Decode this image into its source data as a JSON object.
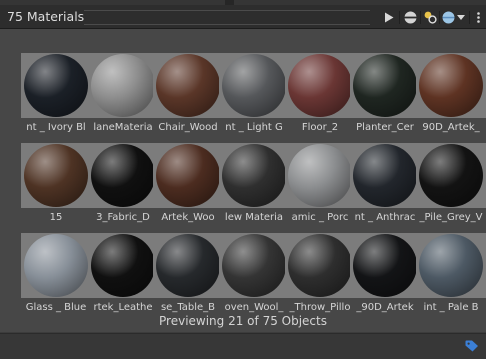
{
  "window": {
    "title": "75 Materials"
  },
  "footer": {
    "status": "Previewing 21 of 75 Objects"
  },
  "toolbar": {
    "icons": [
      "play-icon",
      "sphere-preview-icon",
      "light-toggle-icon",
      "environment-sphere-icon",
      "dropdown-arrow-icon",
      "more-options-icon"
    ]
  },
  "bottom_bar": {
    "icon": "tag-icon",
    "accent_color": "#3b7fd6"
  },
  "materials": [
    {
      "label": "nt _ Ivory Bl",
      "tone": "#1b2027"
    },
    {
      "label": "laneMateria",
      "tone": "#8d8d8d"
    },
    {
      "label": "Chair_Wood",
      "tone": "#5a3628"
    },
    {
      "label": "nt _ Light G",
      "tone": "#55575a"
    },
    {
      "label": "Floor_2",
      "tone": "#6a3634"
    },
    {
      "label": "Planter_Cer",
      "tone": "#1f2621"
    },
    {
      "label": "90D_Artek_",
      "tone": "#5e3323"
    },
    {
      "label": "15",
      "tone": "#4e3324"
    },
    {
      "label": "3_Fabric_D",
      "tone": "#101010"
    },
    {
      "label": "Artek_Woo",
      "tone": "#4c2c20"
    },
    {
      "label": "lew Materia",
      "tone": "#2f2f2f"
    },
    {
      "label": "amic _ Porc",
      "tone": "#8b8d8f"
    },
    {
      "label": "nt _ Anthrac",
      "tone": "#22262c"
    },
    {
      "label": "_Pile_Grey_V",
      "tone": "#131313"
    },
    {
      "label": "Glass _ Blue",
      "tone": "#878f98"
    },
    {
      "label": "rtek_Leathe",
      "tone": "#101010"
    },
    {
      "label": "se_Table_B",
      "tone": "#26292c"
    },
    {
      "label": "oven_Wool_",
      "tone": "#343434"
    },
    {
      "label": "_Throw_Pillo",
      "tone": "#2e2e2e"
    },
    {
      "label": "_90D_Artek",
      "tone": "#131416"
    },
    {
      "label": "int _ Pale B",
      "tone": "#4d5964"
    }
  ]
}
